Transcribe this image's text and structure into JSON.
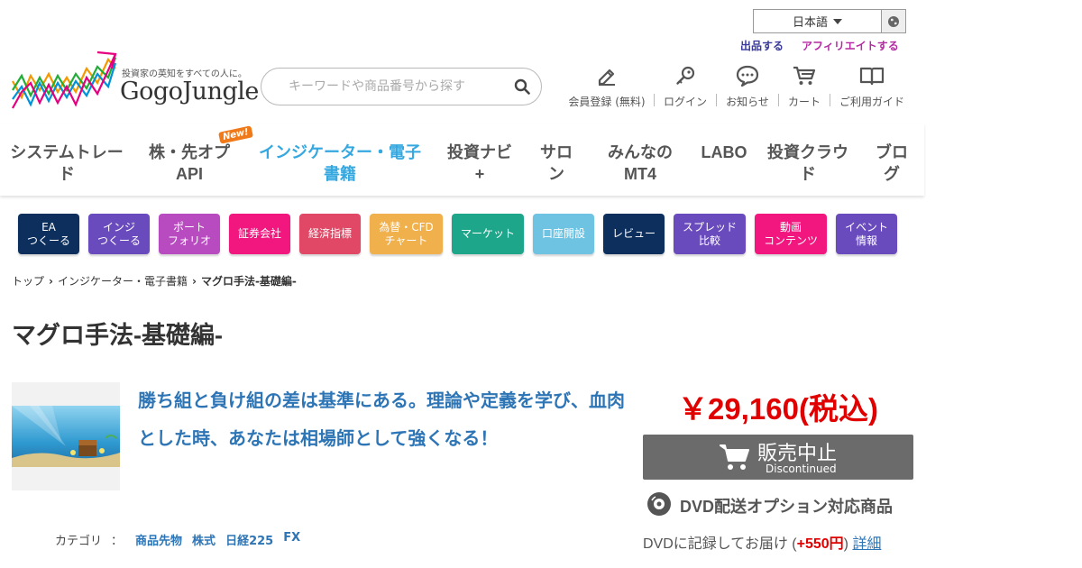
{
  "colors": {
    "accent_blue": "#35a8e0",
    "link_blue": "#2e75b6",
    "price_red": "#e00000",
    "button_gray": "#6b6b6b"
  },
  "topbar": {
    "language": "日本語",
    "globe_icon": "globe-icon",
    "sell_link": "出品する",
    "affiliate_link": "アフィリエイトする"
  },
  "logo": {
    "tagline": "投資家の英知をすべての人に。",
    "name": "GogoJungle"
  },
  "search": {
    "placeholder": "キーワードや商品番号から探す",
    "icon": "search-icon"
  },
  "header_nav": [
    {
      "label": "会員登録 (無料)",
      "icon": "pencil-icon"
    },
    {
      "label": "ログイン",
      "icon": "key-icon"
    },
    {
      "label": "お知らせ",
      "icon": "chat-bubble-icon"
    },
    {
      "label": "カート",
      "icon": "cart-icon"
    },
    {
      "label": "ご利用ガイド",
      "icon": "book-icon"
    }
  ],
  "main_nav": [
    {
      "line1": "システムトレー",
      "line2": "ド"
    },
    {
      "line1": "株・先オプ",
      "line2": "API",
      "badge": "New!"
    },
    {
      "line1": "インジケーター・電子",
      "line2": "書籍",
      "active": true
    },
    {
      "line1": "投資ナビ",
      "line2": "+"
    },
    {
      "line1": "サロ",
      "line2": "ン"
    },
    {
      "line1": "みんなの",
      "line2": "MT4"
    },
    {
      "line1": "LABO",
      "line2": ""
    },
    {
      "line1": "投資クラウ",
      "line2": "ド"
    },
    {
      "line1": "ブロ",
      "line2": "グ"
    }
  ],
  "tiles": [
    {
      "label": "EA\nつくーる",
      "color": "#0d2f5e"
    },
    {
      "label": "インジ\nつくーる",
      "color": "#6a4bbd"
    },
    {
      "label": "ポート\nフォリオ",
      "color": "#b84bc0"
    },
    {
      "label": "証券会社",
      "color": "#f2177f"
    },
    {
      "label": "経済指標",
      "color": "#e04866"
    },
    {
      "label": "為替・CFD\nチャート",
      "color": "#f0b04c"
    },
    {
      "label": "マーケット",
      "color": "#1ea68a"
    },
    {
      "label": "口座開設",
      "color": "#6ec3e3"
    },
    {
      "label": "レビュー",
      "color": "#0d2f5e"
    },
    {
      "label": "スプレッド\n比較",
      "color": "#6a4bbd"
    },
    {
      "label": "動画\nコンテンツ",
      "color": "#f2177f"
    },
    {
      "label": "イベント\n情報",
      "color": "#6a4bbd"
    }
  ],
  "breadcrumb": {
    "home": "トップ",
    "category": "インジケーター・電子書籍",
    "current": "マグロ手法-基礎編-"
  },
  "product": {
    "title": "マグロ手法-基礎編-",
    "catch_copy": "勝ち組と負け組の差は基準にある。理論や定義を学び、血肉とした時、あなたは相場師として強くなる！",
    "category_label": "カテゴリ",
    "category_colon": "：",
    "categories": [
      "商品先物",
      "株式",
      "日経225",
      "FX"
    ],
    "price": "￥29,160(税込)",
    "buy_button": {
      "main": "販売中止",
      "sub": "Discontinued",
      "icon": "cart-icon"
    },
    "dvd_option": "DVD配送オプション対応商品",
    "dvd_note_prefix": "DVDに記録してお届け (",
    "dvd_note_price": "+550円",
    "dvd_note_suffix": ") ",
    "dvd_note_link": "詳細"
  }
}
